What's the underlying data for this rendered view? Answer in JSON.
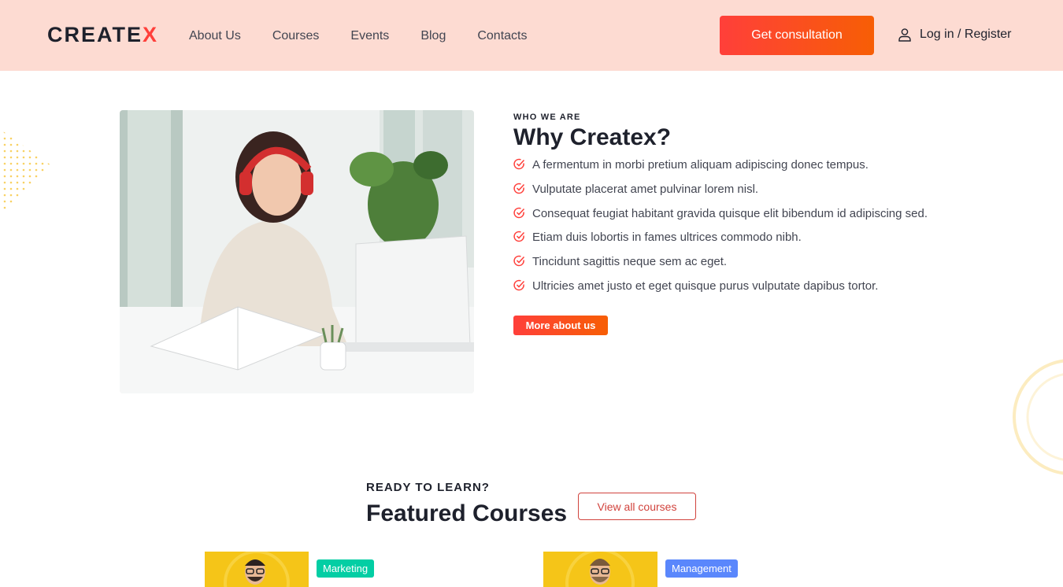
{
  "header": {
    "logo_main": "CREATE",
    "logo_accent": "X",
    "nav": [
      "About Us",
      "Courses",
      "Events",
      "Blog",
      "Contacts"
    ],
    "cta_label": "Get consultation",
    "login_label": "Log in / Register",
    "login_icon": "user-icon"
  },
  "about": {
    "eyebrow": "WHO WE ARE",
    "title": "Why Createx?",
    "items": [
      "A fermentum in morbi pretium aliquam adipiscing donec tempus.",
      "Vulputate placerat amet pulvinar lorem nisl.",
      "Consequat feugiat habitant gravida quisque elit bibendum id adipiscing sed.",
      "Etiam duis lobortis in fames ultrices commodo nibh.",
      "Tincidunt sagittis neque sem ac eget.",
      "Ultricies amet justo et eget quisque purus vulputate dapibus tortor."
    ],
    "check_icon": "check-circle-icon",
    "button_label": "More about us"
  },
  "featured": {
    "eyebrow": "READY TO LEARN?",
    "title": "Featured Courses",
    "button_label": "View all courses",
    "courses": [
      {
        "category": "Marketing",
        "badge_color": "#03cea4"
      },
      {
        "category": "Management",
        "badge_color": "#5a87fc"
      }
    ]
  },
  "colors": {
    "header_bg": "#fddbd2",
    "accent": "#ff3f3a",
    "accent_2": "#f75e05",
    "text_dark": "#1e212c",
    "text_body": "#424551"
  }
}
